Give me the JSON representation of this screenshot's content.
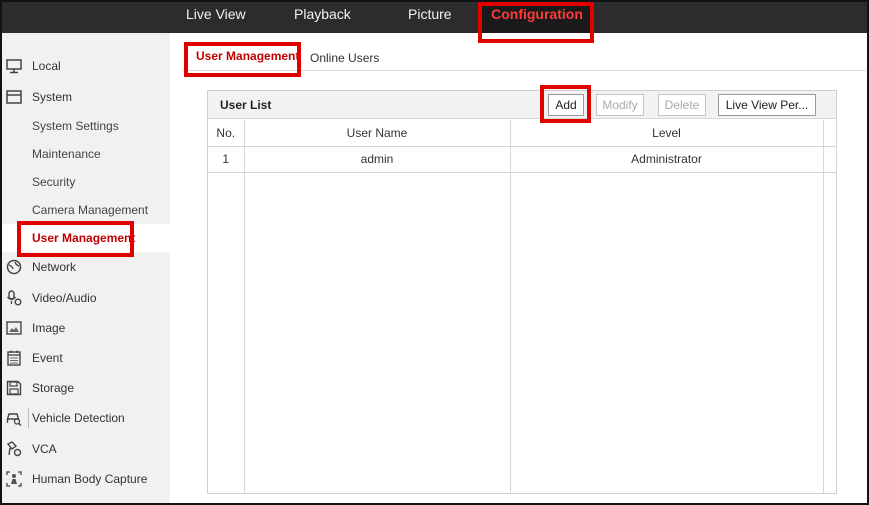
{
  "topnav": [
    "Live View",
    "Playback",
    "Picture",
    "Configuration"
  ],
  "sidebar": {
    "local": "Local",
    "system": "System",
    "system_children": [
      "System Settings",
      "Maintenance",
      "Security",
      "Camera Management",
      "User Management"
    ],
    "network": "Network",
    "video_audio": "Video/Audio",
    "image": "Image",
    "event": "Event",
    "storage": "Storage",
    "vehicle_detection": "Vehicle Detection",
    "vca": "VCA",
    "human_body_capture": "Human Body Capture"
  },
  "tabs": [
    "User Management",
    "Online Users"
  ],
  "user_list": {
    "title": "User List",
    "buttons": {
      "add": "Add",
      "modify": "Modify",
      "delete": "Delete",
      "live_view_permission": "Live View Per..."
    },
    "columns": [
      "No.",
      "User Name",
      "Level"
    ],
    "rows": [
      {
        "no": "1",
        "user_name": "admin",
        "level": "Administrator"
      }
    ]
  },
  "colors": {
    "accent": "#c00000",
    "highlight": "#e00000",
    "topbar": "#2c2c2c"
  }
}
